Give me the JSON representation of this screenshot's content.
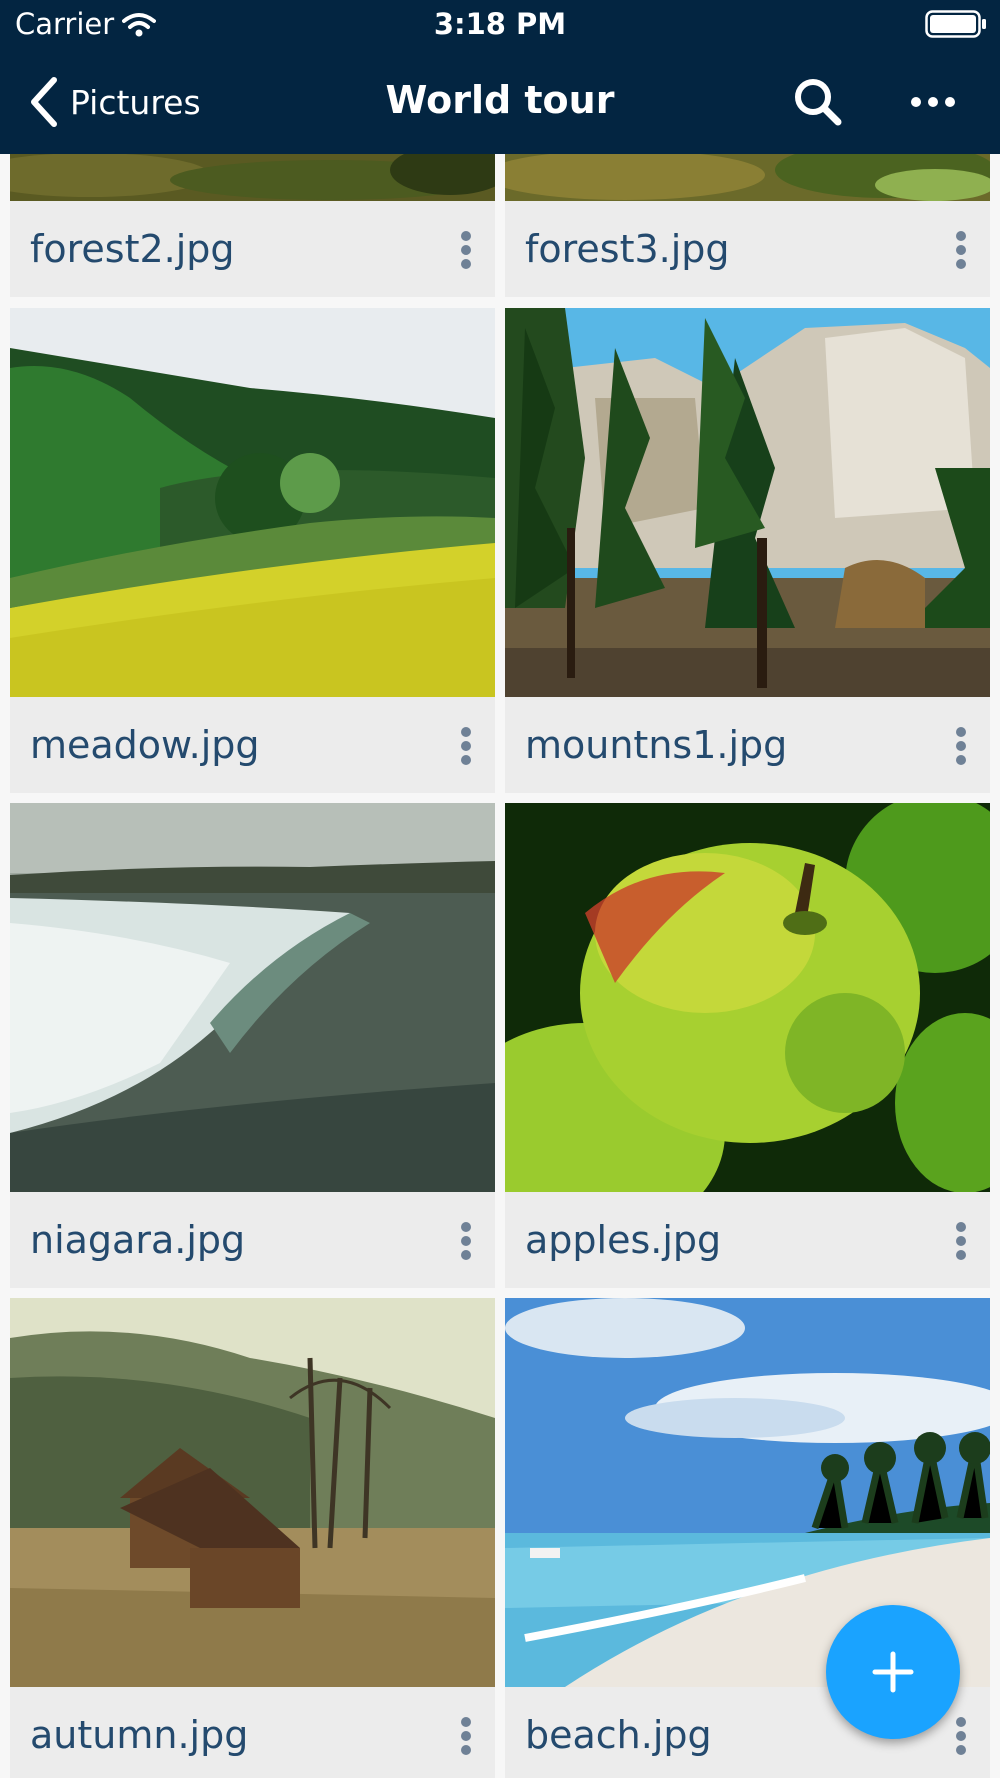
{
  "status_bar": {
    "carrier": "Carrier",
    "time": "3:18 PM"
  },
  "nav": {
    "back_label": "Pictures",
    "title": "World tour"
  },
  "files": [
    {
      "name": "forest2.jpg"
    },
    {
      "name": "forest3.jpg"
    },
    {
      "name": "meadow.jpg"
    },
    {
      "name": "mountns1.jpg"
    },
    {
      "name": "niagara.jpg"
    },
    {
      "name": "apples.jpg"
    },
    {
      "name": "autumn.jpg"
    },
    {
      "name": "beach.jpg"
    }
  ],
  "colors": {
    "header": "#032541",
    "accent": "#1aa3ff",
    "text": "#244a6e"
  }
}
